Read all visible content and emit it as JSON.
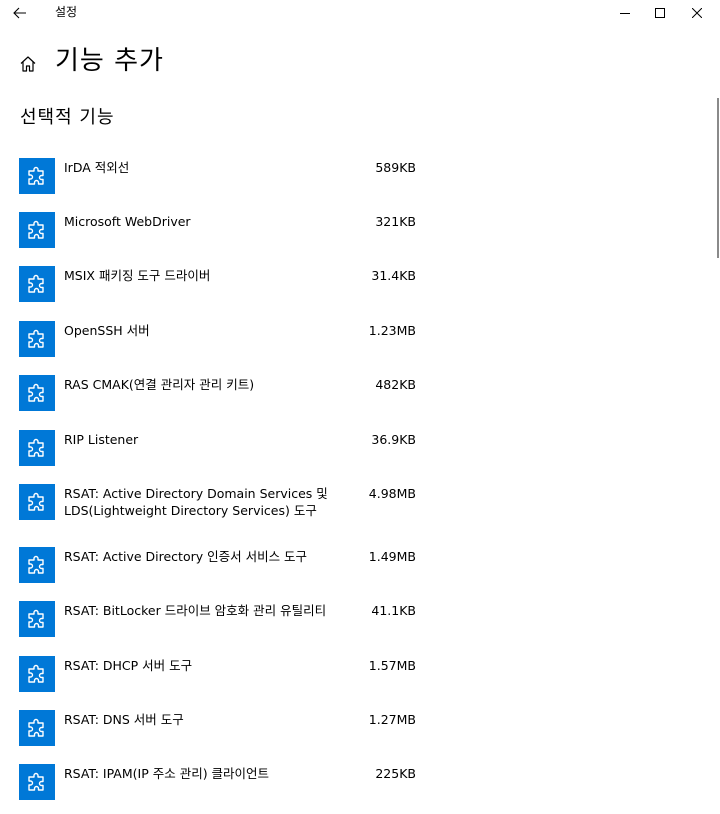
{
  "window": {
    "title": "설정",
    "icons": {
      "back": "arrow-left-icon",
      "minimize": "minimize-icon",
      "maximize": "maximize-icon",
      "close": "close-icon"
    }
  },
  "header": {
    "title": "기능 추가",
    "home_icon": "home-icon"
  },
  "section": {
    "title": "선택적 기능"
  },
  "colors": {
    "accent": "#0078d7",
    "background": "#ffffff",
    "text": "#000000"
  },
  "features": [
    {
      "name": "IrDA 적외선",
      "size": "589KB",
      "icon": "puzzle-icon"
    },
    {
      "name": "Microsoft WebDriver",
      "size": "321KB",
      "icon": "puzzle-icon"
    },
    {
      "name": "MSIX 패키징 도구 드라이버",
      "size": "31.4KB",
      "icon": "puzzle-icon"
    },
    {
      "name": "OpenSSH 서버",
      "size": "1.23MB",
      "icon": "puzzle-icon"
    },
    {
      "name": "RAS CMAK(연결 관리자 관리 키트)",
      "size": "482KB",
      "icon": "puzzle-icon"
    },
    {
      "name": "RIP Listener",
      "size": "36.9KB",
      "icon": "puzzle-icon"
    },
    {
      "name": "RSAT: Active Directory Domain Services 및 LDS(Lightweight Directory Services) 도구",
      "size": "4.98MB",
      "icon": "puzzle-icon"
    },
    {
      "name": "RSAT: Active Directory 인증서 서비스 도구",
      "size": "1.49MB",
      "icon": "puzzle-icon"
    },
    {
      "name": "RSAT: BitLocker 드라이브 암호화 관리 유틸리티",
      "size": "41.1KB",
      "icon": "puzzle-icon"
    },
    {
      "name": "RSAT: DHCP 서버 도구",
      "size": "1.57MB",
      "icon": "puzzle-icon"
    },
    {
      "name": "RSAT: DNS 서버 도구",
      "size": "1.27MB",
      "icon": "puzzle-icon"
    },
    {
      "name": "RSAT: IPAM(IP 주소 관리) 클라이언트",
      "size": "225KB",
      "icon": "puzzle-icon"
    }
  ]
}
